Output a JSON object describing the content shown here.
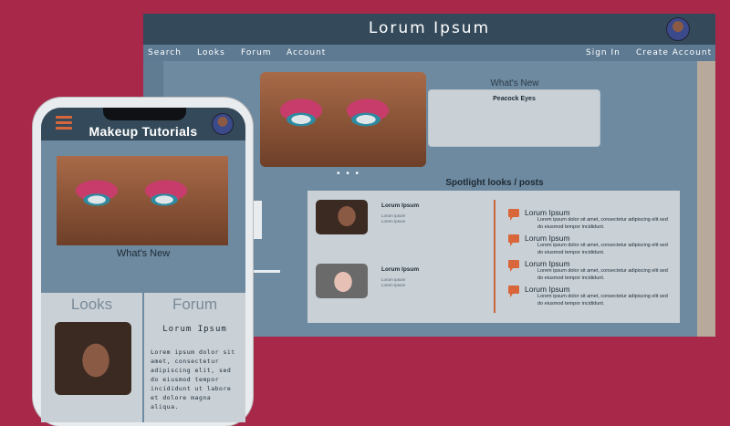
{
  "desktop": {
    "title": "Lorum Ipsum",
    "nav_left": [
      "Search",
      "Looks",
      "Forum",
      "Account"
    ],
    "nav_right": [
      "Sign In",
      "Create Account"
    ],
    "whats_new": "What's New",
    "carousel_dots": "• • •",
    "featured_card": "Peacock Eyes",
    "spotlight_title": "Spotlight looks / posts",
    "spotlight_posts": [
      {
        "name": "Lorum Ipsum",
        "sub": "Lorum Ipsum\nLorem Ipsum"
      },
      {
        "name": "Lorum Ipsum",
        "sub": "Lorum Ipsum\nLorem Ipsum"
      }
    ],
    "comments": [
      {
        "title": "Lorum Ipsum",
        "body": "Lorem ipsum dolor sit amet, consectetur adipiscing elit sed do eiusmod tempor incididunt."
      },
      {
        "title": "Lorum Ipsum",
        "body": "Lorem ipsum dolor sit amet, consectetur adipiscing elit sed do eiusmod tempor incididunt."
      },
      {
        "title": "Lorum Ipsum",
        "body": "Lorem ipsum dolor sit amet, consectetur adipiscing elit sed do eiusmod tempor incididunt."
      },
      {
        "title": "Lorum Ipsum",
        "body": "Lorem ipsum dolor sit amet, consectetur adipiscing elit sed do eiusmod tempor incididunt."
      }
    ]
  },
  "phone": {
    "title": "Makeup Tutorials",
    "whats_new": "What's New",
    "looks_title": "Looks",
    "forum_title": "Forum",
    "forum_head": "Lorum Ipsum",
    "forum_body": "Lorem ipsum dolor sit amet, consectetur adipiscing elit, sed do eiusmod tempor incididunt ut labore et dolore magna aliqua."
  },
  "colors": {
    "background": "#a8284a",
    "header": "#344a5a",
    "accent": "#d9663a",
    "panel": "#c9d1d7"
  },
  "icons": {
    "menu": "hamburger-icon",
    "comment": "comment-icon",
    "avatar": "avatar"
  }
}
